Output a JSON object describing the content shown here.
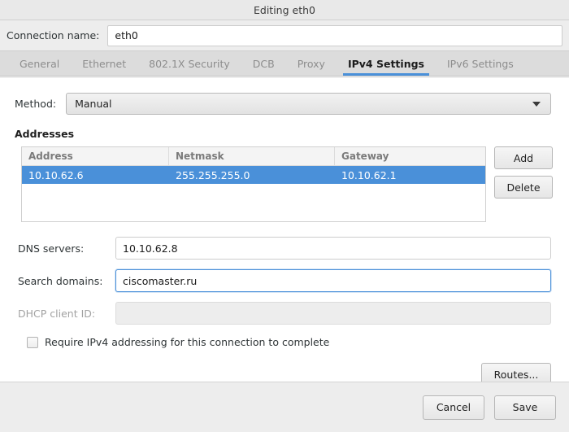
{
  "window": {
    "title": "Editing eth0"
  },
  "connection": {
    "label": "Connection name:",
    "value": "eth0",
    "placeholder": ""
  },
  "tabs": [
    {
      "label": "General",
      "active": false
    },
    {
      "label": "Ethernet",
      "active": false
    },
    {
      "label": "802.1X Security",
      "active": false
    },
    {
      "label": "DCB",
      "active": false
    },
    {
      "label": "Proxy",
      "active": false
    },
    {
      "label": "IPv4 Settings",
      "active": true
    },
    {
      "label": "IPv6 Settings",
      "active": false
    }
  ],
  "method": {
    "label": "Method:",
    "value": "Manual",
    "arrow_icon": "chevron-down-icon"
  },
  "addresses": {
    "section_title": "Addresses",
    "columns": [
      "Address",
      "Netmask",
      "Gateway"
    ],
    "rows": [
      {
        "address": "10.10.62.6",
        "netmask": "255.255.255.0",
        "gateway": "10.10.62.1",
        "selected": true
      }
    ],
    "add_label": "Add",
    "delete_label": "Delete"
  },
  "fields": {
    "dns": {
      "label": "DNS servers:",
      "value": "10.10.62.8",
      "placeholder": ""
    },
    "search_domains": {
      "label": "Search domains:",
      "value": "ciscomaster.ru",
      "placeholder": "",
      "focused": true
    },
    "dhcp_client_id": {
      "label": "DHCP client ID:",
      "value": "",
      "placeholder": "",
      "disabled": true
    }
  },
  "require_ipv4": {
    "label": "Require IPv4 addressing for this connection to complete",
    "checked": false
  },
  "routes": {
    "label": "Routes..."
  },
  "footer": {
    "cancel_label": "Cancel",
    "save_label": "Save"
  },
  "colors": {
    "accent": "#4a90d9",
    "window_bg": "#ededed",
    "panel_bg": "#ffffff",
    "tabbar_bg": "#dcdcdc",
    "muted_text": "#8d8d8d"
  }
}
